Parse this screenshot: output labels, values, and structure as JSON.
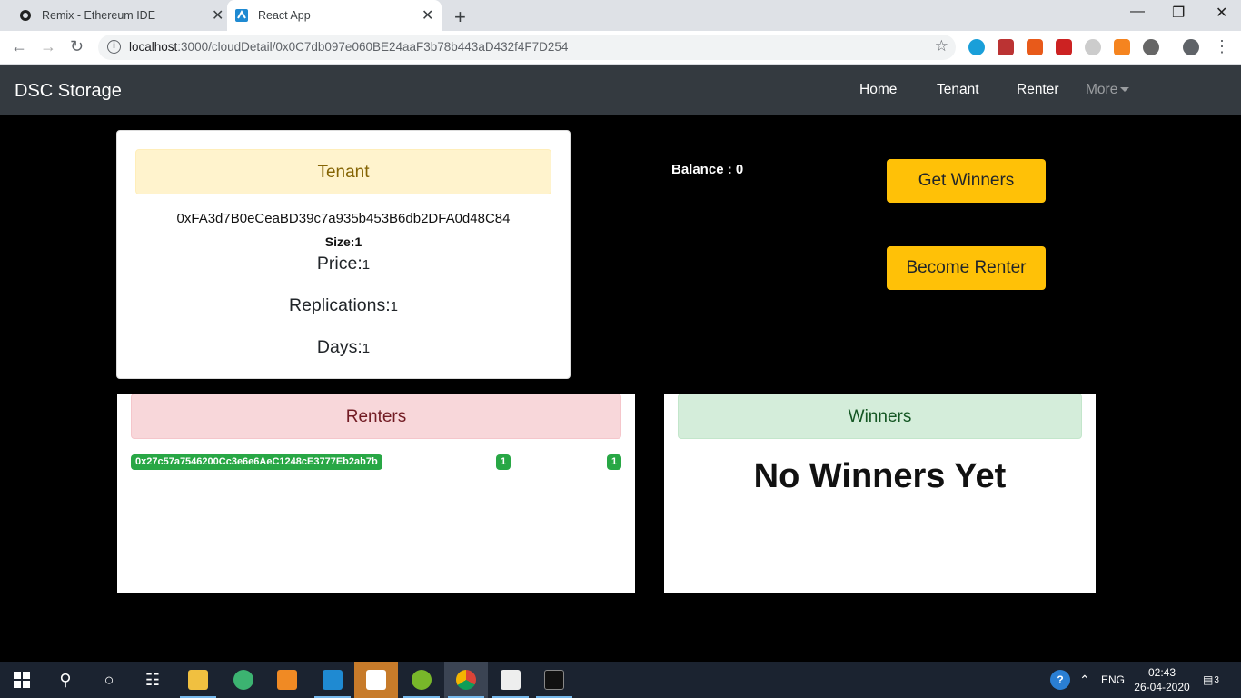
{
  "browser": {
    "tabs": [
      {
        "title": "Remix - Ethereum IDE",
        "active": false
      },
      {
        "title": "React App",
        "active": true
      }
    ],
    "url_host": "localhost",
    "url_path": ":3000/cloudDetail/0x0C7db097e060BE24aaF3b78b443aD432f4F7D254"
  },
  "navbar": {
    "brand": "DSC Storage",
    "links": [
      "Home",
      "Tenant",
      "Renter",
      "More"
    ]
  },
  "tenant": {
    "header": "Tenant",
    "address": "0xFA3d7B0eCeaBD39c7a935b453B6db2DFA0d48C84",
    "size_label": "Size:",
    "size_value": "1",
    "price_label": "Price:",
    "price_value": "1",
    "replications_label": "Replications:",
    "replications_value": "1",
    "days_label": "Days:",
    "days_value": "1"
  },
  "balance": {
    "text": "Balance : 0"
  },
  "actions": {
    "get_winners": "Get Winners",
    "become_renter": "Become Renter"
  },
  "renters": {
    "header": "Renters",
    "rows": [
      {
        "address": "0x27c57a7546200Cc3e6e6AeC1248cE3777Eb2ab7b",
        "a": "1",
        "b": "1"
      }
    ]
  },
  "winners": {
    "header": "Winners",
    "empty_text": "No Winners Yet"
  },
  "taskbar": {
    "lang": "ENG",
    "time": "02:43",
    "date": "26-04-2020",
    "notifications": "3"
  }
}
